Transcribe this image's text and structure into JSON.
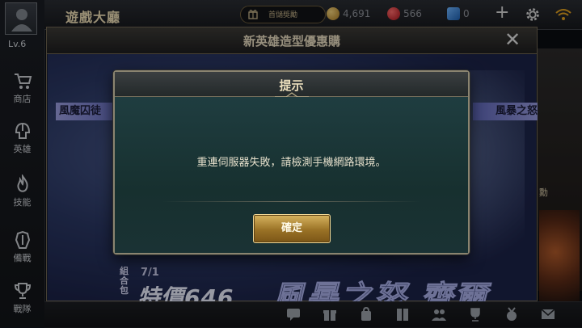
{
  "player": {
    "level": "Lv.6"
  },
  "sidebar": {
    "items": [
      {
        "label": "商店",
        "icon": "cart-icon"
      },
      {
        "label": "英雄",
        "icon": "helmet-icon"
      },
      {
        "label": "技能",
        "icon": "flame-icon"
      },
      {
        "label": "備戰",
        "icon": "armor-icon"
      },
      {
        "label": "戰隊",
        "icon": "trophy-icon"
      }
    ]
  },
  "topbar": {
    "title": "遊戲大廳",
    "pill_label": "首儲獎勵",
    "gold": "4,691",
    "vouchers": "566",
    "diamonds": "0"
  },
  "promo": {
    "title": "新英雄造型優惠購",
    "ribbon_left": "風魔囚徒",
    "ribbon_right": "風暴之怒",
    "combo_label": "組合包",
    "date": "7/1",
    "special_price": "特價646",
    "skin_name": "風暴之怒 齊爾"
  },
  "side_panel": {
    "tag": "勳"
  },
  "dialog": {
    "title": "提示",
    "message": "重連伺服器失敗，請檢測手機網路環境。",
    "confirm_label": "確定"
  },
  "colors": {
    "dialog_bg": "#1e3a3d",
    "confirm_gold": "#c9a24c",
    "ribbon": "#8b90d8"
  }
}
